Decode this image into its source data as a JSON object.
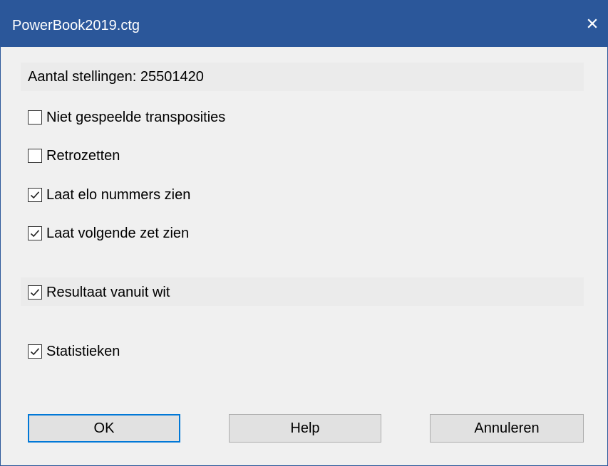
{
  "window": {
    "title": "PowerBook2019.ctg",
    "close_icon": "close-icon",
    "accent_color": "#2b579a"
  },
  "info": {
    "positions_label": "Aantal stellingen: 25501420"
  },
  "options": [
    {
      "label": "Niet gespeelde transposities",
      "checked": false
    },
    {
      "label": "Retrozetten",
      "checked": false
    },
    {
      "label": "Laat elo nummers zien",
      "checked": true
    },
    {
      "label": "Laat volgende zet zien",
      "checked": true
    },
    {
      "label": "Resultaat vanuit wit",
      "checked": true
    },
    {
      "label": "Statistieken",
      "checked": true
    }
  ],
  "buttons": {
    "ok": "OK",
    "help": "Help",
    "cancel": "Annuleren"
  }
}
